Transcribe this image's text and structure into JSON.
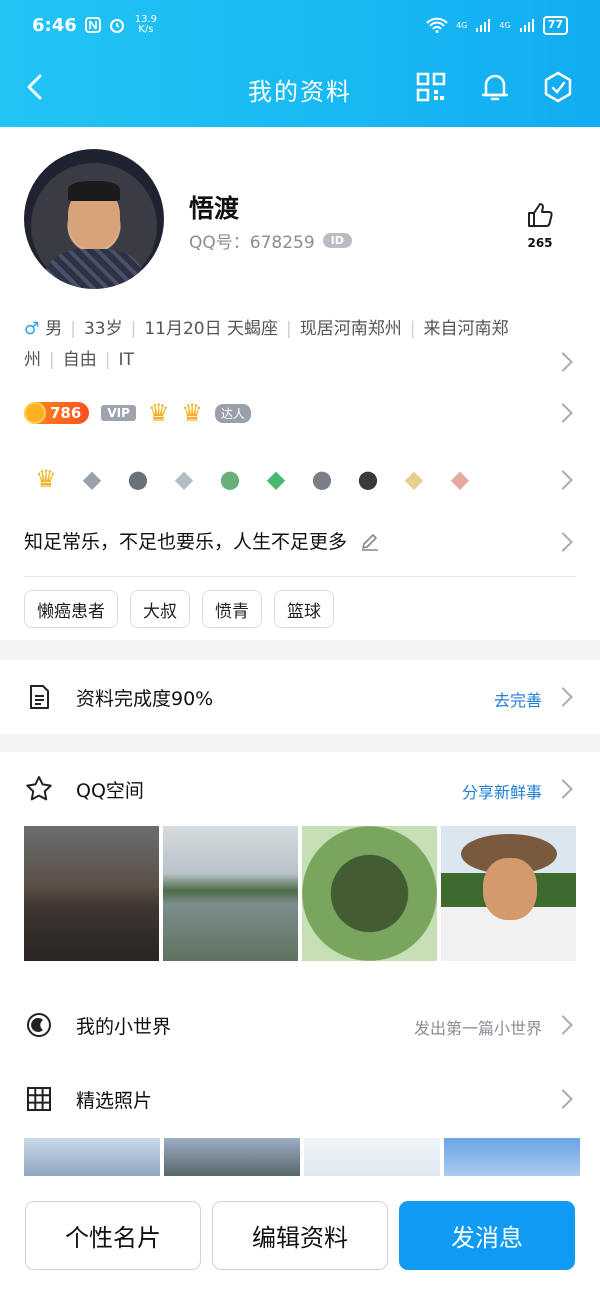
{
  "status": {
    "time": "6:46",
    "speed_value": "13.9",
    "speed_unit": "K/s",
    "net1": "4G",
    "net2": "4G",
    "battery": "77"
  },
  "nav": {
    "title": "我的资料"
  },
  "profile": {
    "name": "悟渡",
    "qq_label": "QQ号：678259",
    "id_badge": "ID",
    "likes": "265",
    "gender": "♂",
    "info": [
      "男",
      "33岁",
      "11月20日  天蝎座",
      "现居河南郑州",
      "来自河南郑州",
      "自由",
      "IT"
    ],
    "coin_value": "786",
    "vip_label": "VIP",
    "talent_label": "达人",
    "signature": "知足常乐，不足也要乐，人生不足更多",
    "tags": [
      "懒癌患者",
      "大叔",
      "愤青",
      "篮球"
    ]
  },
  "completion": {
    "label": "资料完成度90%",
    "action": "去完善"
  },
  "zone": {
    "label": "QQ空间",
    "action": "分享新鲜事"
  },
  "world": {
    "label": "我的小世界",
    "action": "发出第一篇小世界"
  },
  "selected": {
    "label": "精选照片"
  },
  "buttons": {
    "card": "个性名片",
    "edit": "编辑资料",
    "message": "发消息"
  },
  "colors": {
    "accent": "#0f9bf4",
    "topbar": "#18b8f3",
    "link": "#1f7fd6"
  }
}
